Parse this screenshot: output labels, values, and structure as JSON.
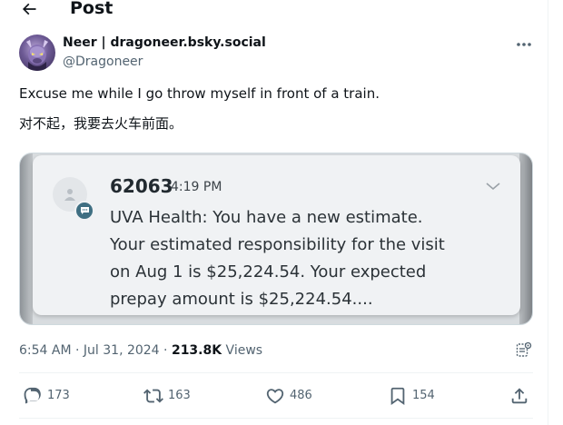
{
  "header": {
    "back_icon": "arrow-left-icon",
    "title": "Post"
  },
  "author": {
    "name": "Neer | dragoneer.bsky.social",
    "handle": "@Dragoneer",
    "avatar_icon": "user-avatar-purple-dragon",
    "more_icon": "more-horizontal-icon"
  },
  "post": {
    "text_en": "Excuse me while I go throw myself in front of a train.",
    "text_zh": "对不起，我要去火车前面。"
  },
  "media": {
    "sender": "62063",
    "time": "4:19 PM",
    "lines": [
      "UVA Health: You have a new estimate.",
      "Your estimated responsibility for the visit",
      "on Aug 1 is $25,224.54. Your expected",
      "prepay amount is $25,224.54...."
    ],
    "badge_icon": "message-bubble-icon",
    "chevron_icon": "chevron-down-icon"
  },
  "meta": {
    "time": "6:54 AM",
    "sep1": " · ",
    "date": "Jul 31, 2024",
    "sep2": " · ",
    "views_count": "213.8K",
    "views_label": " Views",
    "grok_icon": "grok-analyze-icon"
  },
  "actions": {
    "reply_count": "173",
    "repost_count": "163",
    "like_count": "486",
    "bookmark_count": "154",
    "reply_icon": "reply-icon",
    "repost_icon": "repost-icon",
    "like_icon": "heart-icon",
    "bookmark_icon": "bookmark-icon",
    "share_icon": "share-icon"
  },
  "colors": {
    "text_primary": "#0f1419",
    "text_secondary": "#536471",
    "border": "#eff3f4",
    "notif_badge": "#3f6f82"
  }
}
